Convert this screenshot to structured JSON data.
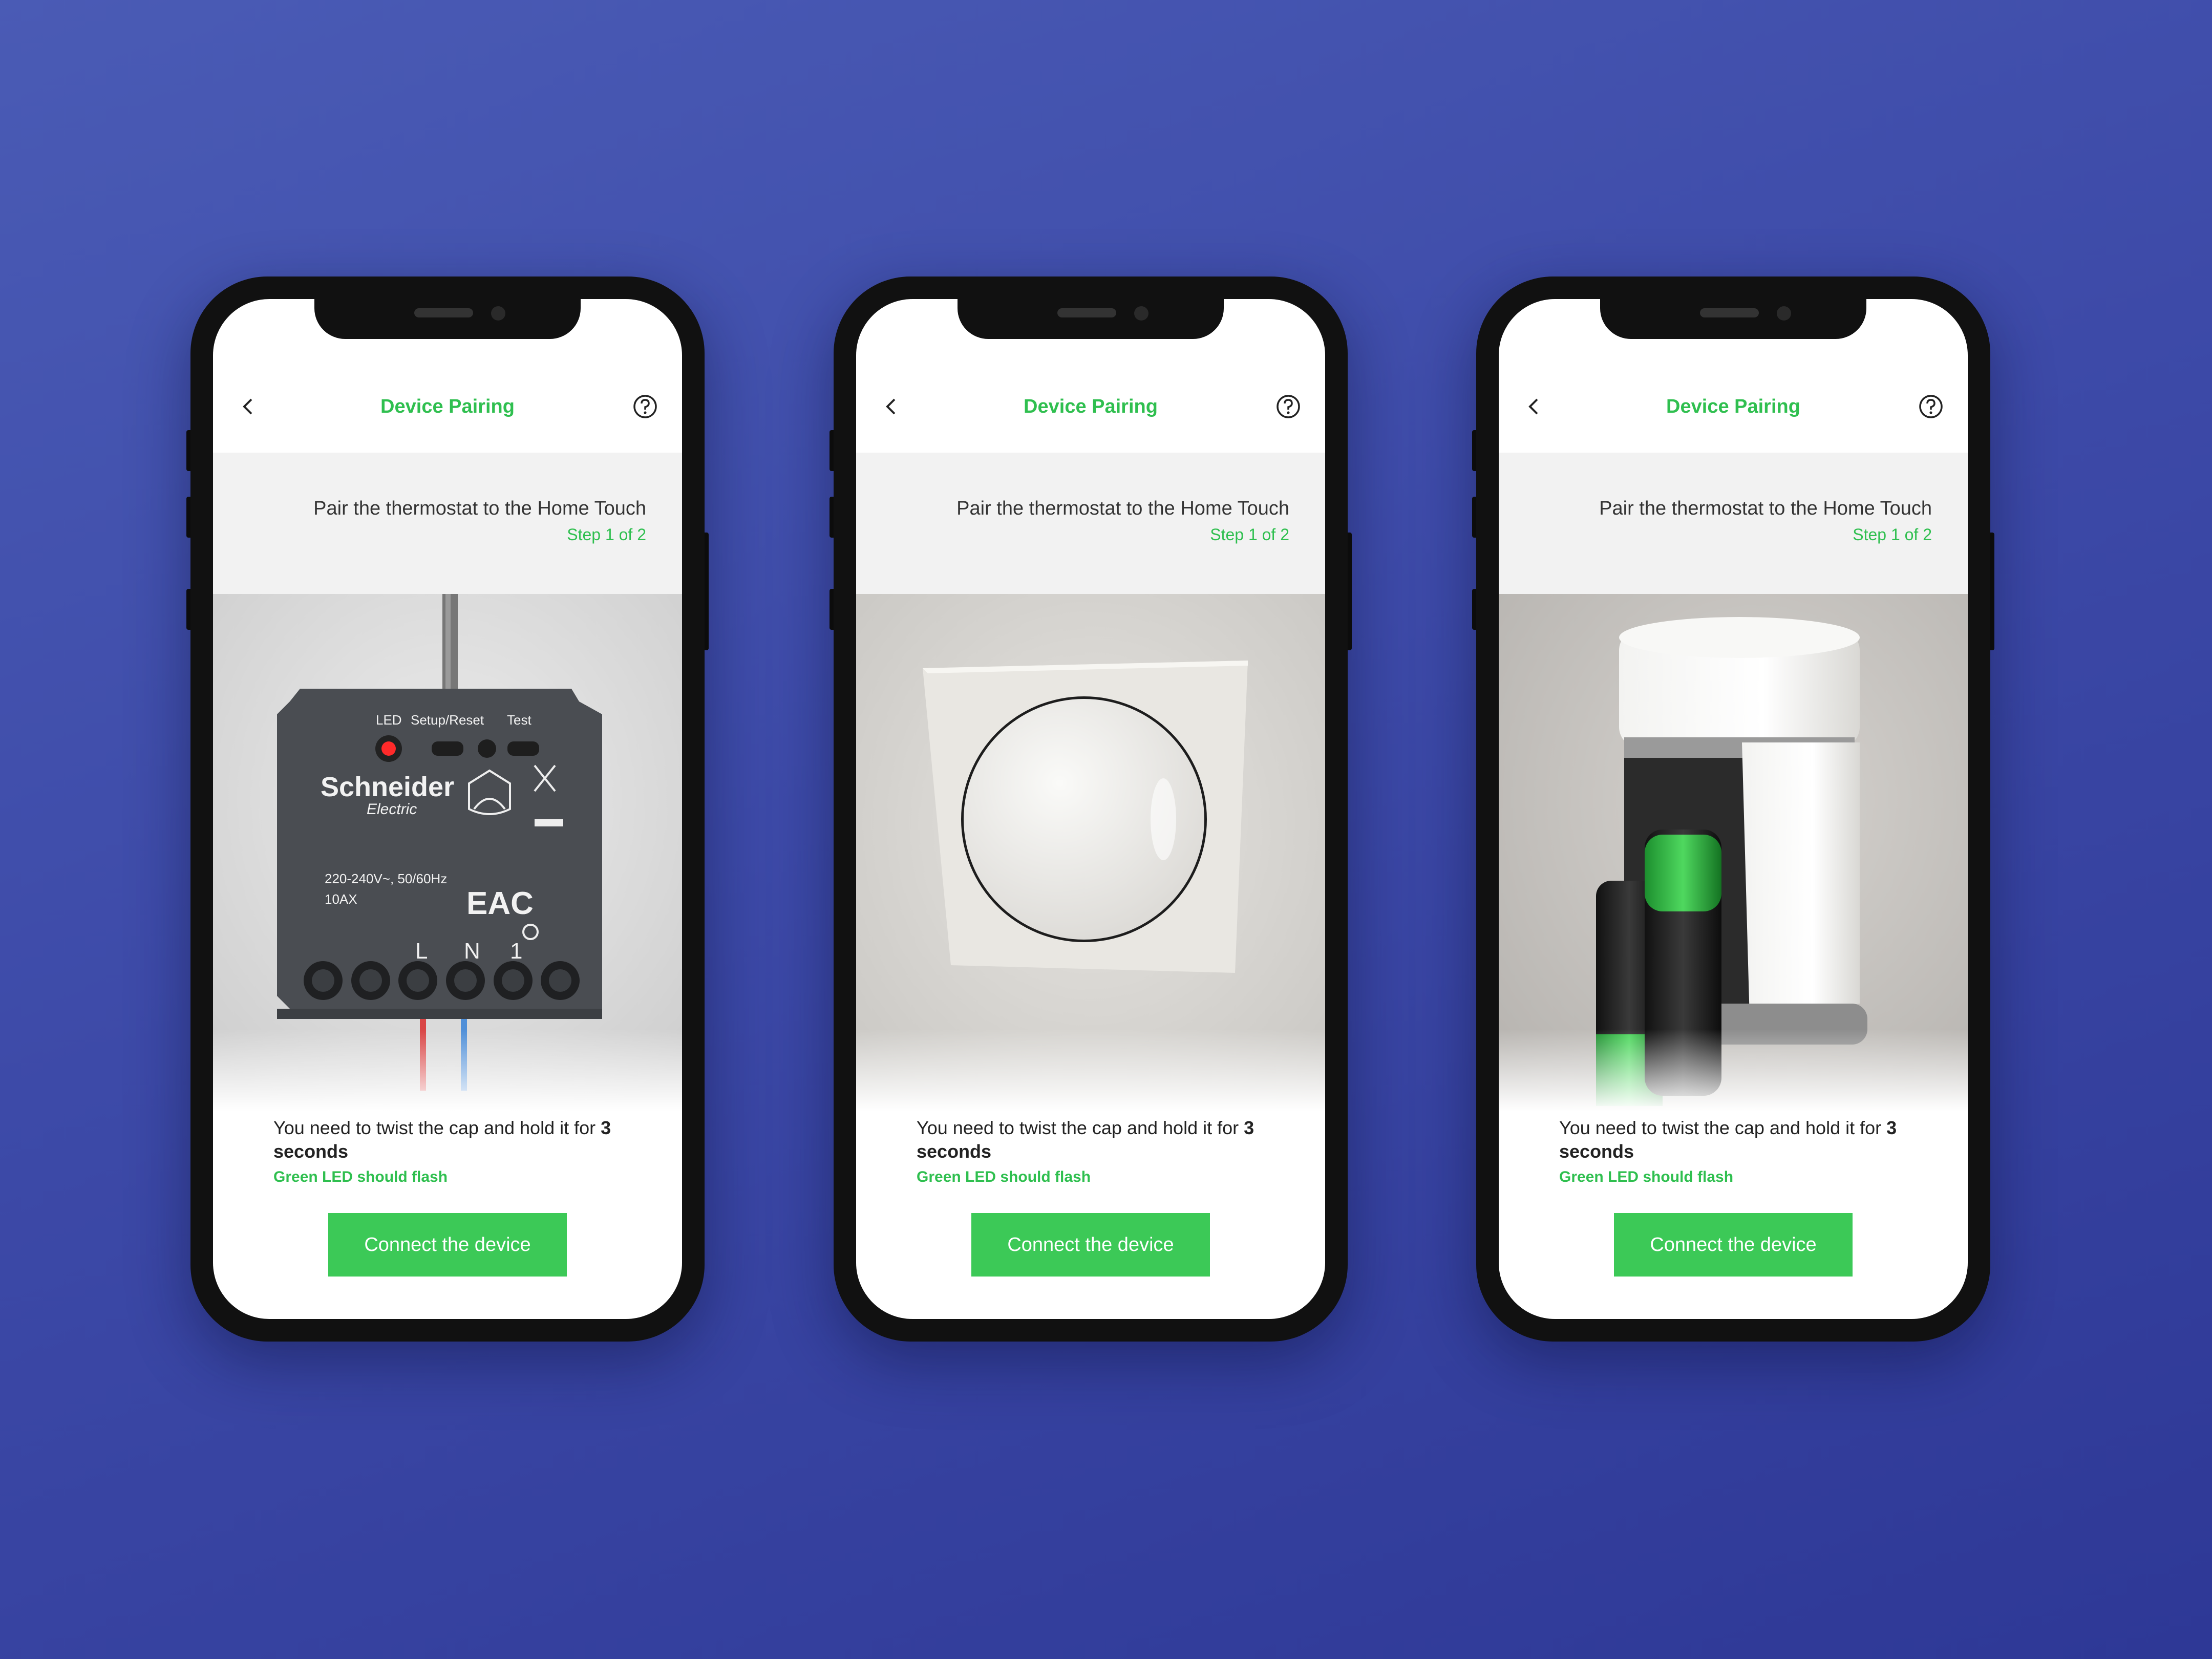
{
  "colors": {
    "background": "#3d4aa8",
    "accent": "#2fbf4f",
    "button": "#3cc957"
  },
  "phones": [
    {
      "header": {
        "back_icon": "chevron-left-icon",
        "title": "Device Pairing",
        "help_icon": "question-circle-icon"
      },
      "instruction": {
        "title": "Pair the thermostat to the Home Touch",
        "step": "Step 1 of 2"
      },
      "hero": {
        "device": "schneider-wiser-module",
        "labels": {
          "led": "LED",
          "setup": "Setup/Reset",
          "test": "Test",
          "brand": "Schneider",
          "brand_sub": "Electric",
          "rating": "220-240V~, 50/60Hz",
          "amps": "10AX",
          "cert": "EAC",
          "terminals": [
            "L",
            "N",
            "1"
          ]
        }
      },
      "body": {
        "text": "You need to twist the cap and hold it for",
        "bold_value": "3",
        "bold_unit": "seconds",
        "note": "Green LED should flash"
      },
      "cta": "Connect the device"
    },
    {
      "header": {
        "back_icon": "chevron-left-icon",
        "title": "Device Pairing",
        "help_icon": "question-circle-icon"
      },
      "instruction": {
        "title": "Pair the thermostat to the Home Touch",
        "step": "Step 1 of 2"
      },
      "hero": {
        "device": "wall-dial-thermostat"
      },
      "body": {
        "text": "You need to twist the cap and hold it for",
        "bold_value": "3",
        "bold_unit": "seconds",
        "note": "Green LED should flash"
      },
      "cta": "Connect the device"
    },
    {
      "header": {
        "back_icon": "chevron-left-icon",
        "title": "Device Pairing",
        "help_icon": "question-circle-icon"
      },
      "instruction": {
        "title": "Pair the thermostat to the Home Touch",
        "step": "Step 1 of 2"
      },
      "hero": {
        "device": "radiator-valve-batteries"
      },
      "body": {
        "text": "You need to twist the cap and hold it for",
        "bold_value": "3",
        "bold_unit": "seconds",
        "note": "Green LED should flash"
      },
      "cta": "Connect the device"
    }
  ]
}
